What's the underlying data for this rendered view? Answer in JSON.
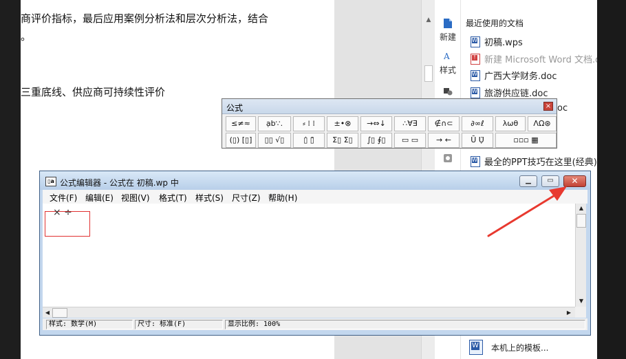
{
  "document": {
    "lines": [
      "商评价指标，最后应用案例分析法和层次分析法，结合",
      "。",
      "三重底线、供应商可持续性评价"
    ]
  },
  "taskpane": {
    "new_label": "新建",
    "style_label": "样式",
    "recent_header": "最近使用的文档",
    "recent_files": [
      "初稿.wps",
      "新建 Microsoft Word 文档.doc",
      "广西大学财务.doc",
      "旅游供应链.doc",
      "oc",
      "最全的PPT技巧在这里(经典).d"
    ],
    "template_label": "本机上的模板..."
  },
  "formula_toolbar": {
    "title": "公式",
    "close_label": "×",
    "row1": [
      "≤≠≈",
      "ạb∵.",
      "⸗ ⁞ ⁞",
      "±•⊗",
      "→⇔↓",
      "∴∀∃",
      "∉∩⊂",
      "∂∞ℓ",
      "λωθ",
      "ΛΩ⊛"
    ],
    "row2": [
      "(▯) [▯]",
      "▯▯ √▯",
      "▯̇ ▯̄",
      "Σ▯ Σ▯",
      "∫▯ ∮▯",
      "▭ ▭",
      "→ ←",
      "Ū Ụ̈",
      "▫▫▫ ▦"
    ]
  },
  "editor": {
    "title": "公式编辑器 - 公式在 初稿.wp 中",
    "app_icon_label": "▯a",
    "buttons": {
      "min": "▁",
      "max": "▭",
      "close": "✕"
    },
    "menu": [
      "文件(F)",
      "编辑(E)",
      "视图(V)",
      "格式(T)",
      "样式(S)",
      "尺寸(Z)",
      "帮助(H)"
    ],
    "formula": "× ÷",
    "status": {
      "style": "样式: 数学(M)",
      "size": "尺寸: 标准(F)",
      "zoom": "显示比例: 100%"
    },
    "scroll_glyphs": {
      "up": "▲",
      "down": "▼",
      "left": "◀",
      "right": "▶"
    }
  },
  "colors": {
    "annotation_arrow": "#e8392f",
    "selection_box": "#e03030",
    "title_close": "#c34234"
  }
}
